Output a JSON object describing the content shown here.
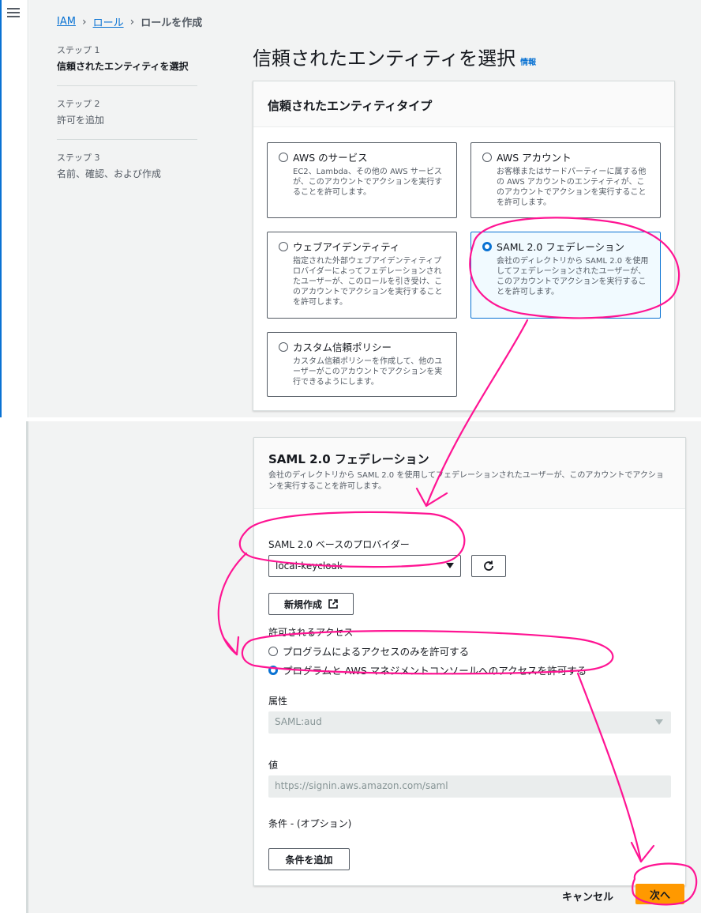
{
  "breadcrumb": {
    "root": "IAM",
    "roles": "ロール",
    "current": "ロールを作成"
  },
  "steps": [
    {
      "num": "ステップ 1",
      "label": "信頼されたエンティティを選択"
    },
    {
      "num": "ステップ 2",
      "label": "許可を追加"
    },
    {
      "num": "ステップ 3",
      "label": "名前、確認、および作成"
    }
  ],
  "page": {
    "title": "信頼されたエンティティを選択",
    "info": "情報"
  },
  "entity_panel": {
    "title": "信頼されたエンティティタイプ",
    "options": [
      {
        "title": "AWS のサービス",
        "desc": "EC2、Lambda、その他の AWS サービスが、このアカウントでアクションを実行することを許可します。",
        "selected": false
      },
      {
        "title": "AWS アカウント",
        "desc": "お客様またはサードパーティーに属する他の AWS アカウントのエンティティが、このアカウントでアクションを実行することを許可します。",
        "selected": false
      },
      {
        "title": "ウェブアイデンティティ",
        "desc": "指定された外部ウェブアイデンティティプロバイダーによってフェデレーションされたユーザーが、このロールを引き受け、このアカウントでアクションを実行することを許可します。",
        "selected": false
      },
      {
        "title": "SAML 2.0 フェデレーション",
        "desc": "会社のディレクトリから SAML 2.0 を使用してフェデレーションされたユーザーが、このアカウントでアクションを実行することを許可します。",
        "selected": true
      },
      {
        "title": "カスタム信頼ポリシー",
        "desc": "カスタム信頼ポリシーを作成して、他のユーザーがこのアカウントでアクションを実行できるようにします。",
        "selected": false
      }
    ]
  },
  "saml_panel": {
    "title": "SAML 2.0 フェデレーション",
    "desc": "会社のディレクトリから SAML 2.0 を使用してフェデレーションされたユーザーが、このアカウントでアクションを実行することを許可します。",
    "provider_label": "SAML 2.0 ベースのプロバイダー",
    "provider_value": "local-keycloak",
    "new_button": "新規作成",
    "access_label": "許可されるアクセス",
    "access_options": [
      {
        "label": "プログラムによるアクセスのみを許可する",
        "selected": false
      },
      {
        "label": "プログラムと AWS マネジメントコンソールへのアクセスを許可する",
        "selected": true
      }
    ],
    "attribute_label": "属性",
    "attribute_value": "SAML:aud",
    "value_label": "値",
    "value_value": "https://signin.aws.amazon.com/saml",
    "condition_label": "条件 - (オプション)",
    "add_condition_button": "条件を追加"
  },
  "footer": {
    "cancel": "キャンセル",
    "next": "次へ"
  },
  "colors": {
    "accent": "#0972d3",
    "primary_button": "#ff9900",
    "annotation": "#ff1493"
  },
  "icons": [
    "menu-icon",
    "chevron-right-icon",
    "refresh-icon",
    "external-link-icon",
    "caret-down-icon"
  ]
}
